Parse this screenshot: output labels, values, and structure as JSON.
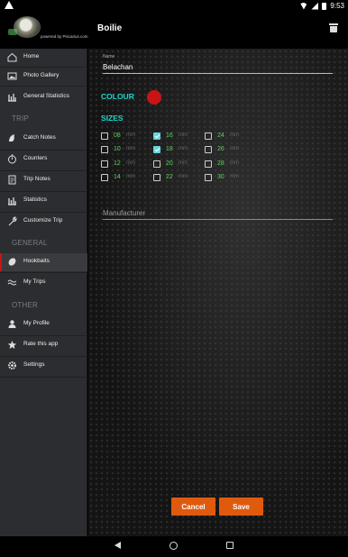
{
  "status_bar": {
    "time": "9:53",
    "icons": [
      "warning-icon",
      "wifi-icon",
      "signal-icon",
      "battery-icon"
    ]
  },
  "toolbar": {
    "powered_by": "powered by Piscarius.com",
    "title": "Boilie",
    "delete_icon": "trash-icon"
  },
  "sidebar": {
    "items": [
      {
        "label": "Home",
        "icon": "home-icon"
      },
      {
        "label": "Photo Gallery",
        "icon": "gallery-icon"
      },
      {
        "label": "General Statistics",
        "icon": "bar-chart-icon"
      }
    ],
    "sections": [
      {
        "title": "TRIP",
        "items": [
          {
            "label": "Catch Notes",
            "icon": "fish-icon"
          },
          {
            "label": "Counters",
            "icon": "timer-icon"
          },
          {
            "label": "Trip Notes",
            "icon": "notes-icon"
          },
          {
            "label": "Statistics",
            "icon": "bar-chart-icon"
          },
          {
            "label": "Customize Trip",
            "icon": "wrench-icon"
          }
        ]
      },
      {
        "title": "GENERAL",
        "items": [
          {
            "label": "Hookbaits",
            "icon": "boilie-icon",
            "active": true
          },
          {
            "label": "My Trips",
            "icon": "waves-icon"
          }
        ]
      },
      {
        "title": "OTHER",
        "items": [
          {
            "label": "My Profile",
            "icon": "person-icon"
          },
          {
            "label": "Rate this app",
            "icon": "star-icon"
          },
          {
            "label": "Settings",
            "icon": "gear-icon"
          }
        ]
      }
    ]
  },
  "form": {
    "name_label": "Name",
    "name_value": "Belachan",
    "colour_label": "COLOUR",
    "colour_value": "#c81414",
    "sizes_label": "SIZES",
    "sizes": [
      {
        "value": "08",
        "unit": "mm",
        "checked": false
      },
      {
        "value": "10",
        "unit": "mm",
        "checked": false
      },
      {
        "value": "12",
        "unit": "mm",
        "checked": false
      },
      {
        "value": "14",
        "unit": "mm",
        "checked": false
      },
      {
        "value": "16",
        "unit": "mm",
        "checked": true
      },
      {
        "value": "18",
        "unit": "mm",
        "checked": true
      },
      {
        "value": "20",
        "unit": "mm",
        "checked": false
      },
      {
        "value": "22",
        "unit": "mm",
        "checked": false
      },
      {
        "value": "24",
        "unit": "mm",
        "checked": false
      },
      {
        "value": "26",
        "unit": "mm",
        "checked": false
      },
      {
        "value": "28",
        "unit": "mm",
        "checked": false
      },
      {
        "value": "30",
        "unit": "mm",
        "checked": false
      }
    ],
    "manufacturer_placeholder": "Manufacturer",
    "manufacturer_value": "",
    "cancel_label": "Cancel",
    "save_label": "Save"
  },
  "colors": {
    "accent_teal": "#1fd4c8",
    "button_orange": "#e05a0e",
    "active_marker": "#c21818",
    "size_green": "#5fd35f"
  }
}
